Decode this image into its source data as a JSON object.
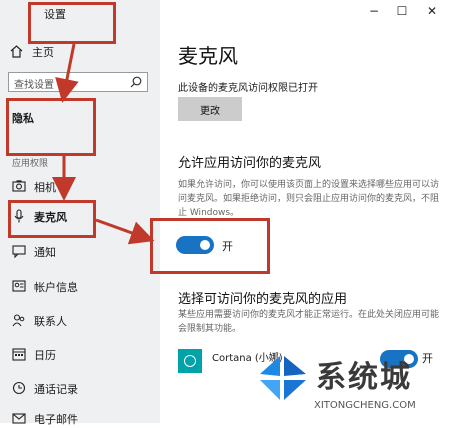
{
  "window": {
    "title": "设置",
    "controls": [
      "−",
      "☐",
      "✕"
    ]
  },
  "sidebar": {
    "home_label": "主页",
    "search_placeholder": "查找设置",
    "section_title": "隐私",
    "section_sub": "应用权限",
    "items": [
      {
        "label": "相机",
        "icon": "camera-icon"
      },
      {
        "label": "麦克风",
        "icon": "microphone-icon",
        "active": true
      },
      {
        "label": "通知",
        "icon": "notification-icon"
      },
      {
        "label": "帐户信息",
        "icon": "account-info-icon"
      },
      {
        "label": "联系人",
        "icon": "contacts-icon"
      },
      {
        "label": "日历",
        "icon": "calendar-icon"
      },
      {
        "label": "通话记录",
        "icon": "call-history-icon"
      },
      {
        "label": "电子邮件",
        "icon": "email-icon"
      }
    ]
  },
  "main": {
    "title": "麦克风",
    "device_status": "此设备的麦克风访问权限已打开",
    "change_button": "更改",
    "allow_heading": "允许应用访问你的麦克风",
    "allow_desc": "如果允许访问，你可以使用该页面上的设置来选择哪些应用可以访问麦克风。如果拒绝访问，则只会阻止应用访问你的麦克风，不阻止 Windows。",
    "allow_toggle_label": "开",
    "choose_heading": "选择可访问你的麦克风的应用",
    "choose_desc": "某些应用需要访问你的麦克风才能正常运行。在此处关闭应用可能会限制其功能。",
    "app_name": "Cortana (小娜)",
    "app_toggle_label": "开"
  },
  "watermark": {
    "text": "系统城",
    "url": "XITONGCHENG.COM"
  },
  "colors": {
    "accent": "#1873c4",
    "annotation_red": "#c0392b",
    "sidebar_bg": "#eef0f1"
  }
}
